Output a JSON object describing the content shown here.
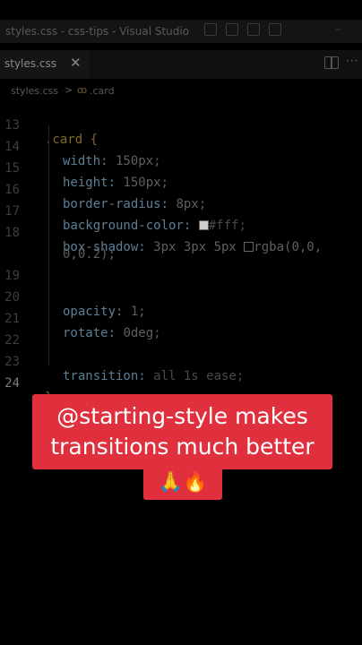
{
  "window": {
    "title": "styles.css - css-tips - Visual Studio"
  },
  "tab": {
    "label": "styles.css",
    "close": "✕"
  },
  "breadcrumb": {
    "file": "styles.css",
    "separator": ">",
    "symbol_icon": "selector-symbol-icon",
    "symbol": ".card"
  },
  "editor": {
    "lines": [
      {
        "n": "13",
        "text": ".card {"
      },
      {
        "n": "14",
        "prop": "width:",
        "value": " 150px;"
      },
      {
        "n": "15",
        "prop": "height:",
        "value": " 150px;"
      },
      {
        "n": "16",
        "prop": "border-radius:",
        "value": " 8px;"
      },
      {
        "n": "17",
        "prop": "background-color:",
        "value": "#fff;"
      },
      {
        "n": "18",
        "prop": "box-shadow:",
        "value": " 3px 3px 5px ",
        "value2": "rgba(0,0,",
        "wrap": "0,0.2);"
      },
      {
        "n": "19",
        "text": ""
      },
      {
        "n": "20",
        "prop": "opacity:",
        "value": " 1;"
      },
      {
        "n": "21",
        "prop": "rotate:",
        "value": " 0deg;"
      },
      {
        "n": "22",
        "text": ""
      },
      {
        "n": "23",
        "prop": "transition:",
        "value": " all 1s ease;"
      },
      {
        "n": "24",
        "text": "}"
      }
    ]
  },
  "caption": {
    "line1": "@starting-style makes",
    "line2": "transitions much better",
    "emoji": "🙏🔥"
  },
  "colors": {
    "caption_bg": "#e0303e"
  }
}
